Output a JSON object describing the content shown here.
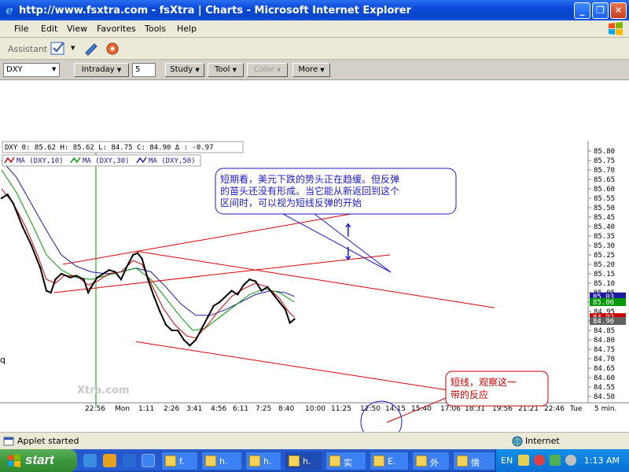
{
  "window": {
    "title": "http://www.fsxtra.com - fsXtra | Charts - Microsoft Internet Explorer",
    "buttons": [
      "_",
      "❐",
      "✕"
    ]
  },
  "menu": [
    "File",
    "Edit",
    "View",
    "Favorites",
    "Tools",
    "Help"
  ],
  "assistant": {
    "label": "Assistant"
  },
  "toolbar": {
    "symbol": "DXY",
    "period": "Intraday",
    "interval": "5",
    "study": "Study",
    "tool": "Tool",
    "color": "Color",
    "more": "More"
  },
  "legend": {
    "quote": "DXY   0: 85.62  H: 85.62  L: 84.75  C: 84.90   Δ : -0.97",
    "ma": [
      "MA (DXY,10)",
      "MA (DXY,30)",
      "MA (DXY,50)"
    ]
  },
  "colors": {
    "price": "#000000",
    "ma10": "#cc0000",
    "ma30": "#009900",
    "ma50": "#1a1aa0",
    "channel": "#e00000",
    "annotation_blue": "#1a1acc",
    "annotation_red": "#cc0000",
    "price_tag_bg": "#1a1aa0",
    "ma10_tag_bg": "#cc0000",
    "ma30_tag_bg": "#009900"
  },
  "annotations": {
    "note_blue": "短期看，美元下跌的势头正在趋缓。但反弹的苗头还没有形成。当它能从新返回到这个区间时，可以视为短线反弹的开始",
    "note_red": "短线，观察这一带的反应",
    "watermark": "Xtra.com",
    "left_label": "q"
  },
  "chart_data": {
    "type": "line",
    "title": "",
    "symbol": "DXY",
    "interval": "5 min.",
    "xlabel": "",
    "ylabel": "",
    "ylim": [
      84.45,
      85.85
    ],
    "yticks": [
      85.8,
      85.75,
      85.7,
      85.65,
      85.6,
      85.55,
      85.5,
      85.45,
      85.4,
      85.35,
      85.3,
      85.25,
      85.2,
      85.15,
      85.1,
      85.05,
      85.0,
      84.95,
      84.9,
      84.85,
      84.8,
      84.75,
      84.7,
      84.65,
      84.6,
      84.55,
      84.5
    ],
    "xticks": [
      "22:56",
      "Mon",
      "1:11",
      "2:26",
      "3:41",
      "4:56",
      "6:11",
      "7:25",
      "8:40",
      "10:00",
      "11:25",
      "12:50",
      "14:15",
      "15:40",
      "17:06",
      "18:31",
      "19:56",
      "21:21",
      "22:46",
      "Tue"
    ],
    "x_unit_label": "5 min.",
    "ohlc_summary": {
      "open": 85.62,
      "high": 85.62,
      "low": 84.75,
      "close": 84.9,
      "change": -0.97
    },
    "last_values": {
      "price": 84.9,
      "ma10": 84.92,
      "ma30": 85.0,
      "ma50": 85.03
    },
    "series": [
      {
        "name": "DXY",
        "points": [
          [
            0,
            85.55
          ],
          [
            4,
            85.57
          ],
          [
            8,
            85.52
          ],
          [
            14,
            85.4
          ],
          [
            20,
            85.3
          ],
          [
            26,
            85.18
          ],
          [
            30,
            85.06
          ],
          [
            33,
            85.05
          ],
          [
            36,
            85.12
          ],
          [
            40,
            85.15
          ],
          [
            46,
            85.13
          ],
          [
            50,
            85.14
          ],
          [
            55,
            85.12
          ],
          [
            58,
            85.05
          ],
          [
            60,
            85.08
          ],
          [
            64,
            85.13
          ],
          [
            68,
            85.15
          ],
          [
            72,
            85.17
          ],
          [
            76,
            85.16
          ],
          [
            80,
            85.12
          ],
          [
            84,
            85.19
          ],
          [
            88,
            85.25
          ],
          [
            91,
            85.26
          ],
          [
            94,
            85.23
          ],
          [
            98,
            85.12
          ],
          [
            102,
            85.03
          ],
          [
            106,
            84.95
          ],
          [
            110,
            84.88
          ],
          [
            114,
            84.85
          ],
          [
            118,
            84.85
          ],
          [
            122,
            84.8
          ],
          [
            126,
            84.77
          ],
          [
            130,
            84.8
          ],
          [
            134,
            84.86
          ],
          [
            138,
            84.92
          ],
          [
            142,
            84.98
          ],
          [
            146,
            85.0
          ],
          [
            150,
            85.03
          ],
          [
            154,
            85.06
          ],
          [
            158,
            85.04
          ],
          [
            162,
            85.09
          ],
          [
            166,
            85.12
          ],
          [
            170,
            85.11
          ],
          [
            174,
            85.06
          ],
          [
            178,
            85.08
          ],
          [
            182,
            85.04
          ],
          [
            186,
            85.0
          ],
          [
            190,
            84.96
          ],
          [
            193,
            84.89
          ],
          [
            196,
            84.91
          ]
        ]
      },
      {
        "name": "MA (DXY,10)",
        "points": [
          [
            0,
            85.6
          ],
          [
            8,
            85.52
          ],
          [
            16,
            85.4
          ],
          [
            24,
            85.25
          ],
          [
            30,
            85.12
          ],
          [
            36,
            85.1
          ],
          [
            42,
            85.14
          ],
          [
            50,
            85.14
          ],
          [
            58,
            85.09
          ],
          [
            64,
            85.11
          ],
          [
            72,
            85.15
          ],
          [
            80,
            85.16
          ],
          [
            88,
            85.22
          ],
          [
            94,
            85.2
          ],
          [
            100,
            85.1
          ],
          [
            108,
            84.97
          ],
          [
            116,
            84.88
          ],
          [
            124,
            84.82
          ],
          [
            130,
            84.81
          ],
          [
            138,
            84.88
          ],
          [
            146,
            84.96
          ],
          [
            154,
            85.03
          ],
          [
            162,
            85.07
          ],
          [
            170,
            85.1
          ],
          [
            178,
            85.08
          ],
          [
            186,
            85.02
          ],
          [
            192,
            84.95
          ],
          [
            196,
            84.92
          ]
        ]
      },
      {
        "name": "MA (DXY,30)",
        "points": [
          [
            0,
            85.7
          ],
          [
            10,
            85.58
          ],
          [
            20,
            85.42
          ],
          [
            30,
            85.25
          ],
          [
            40,
            85.17
          ],
          [
            50,
            85.13
          ],
          [
            60,
            85.12
          ],
          [
            70,
            85.14
          ],
          [
            80,
            85.16
          ],
          [
            90,
            85.18
          ],
          [
            100,
            85.12
          ],
          [
            110,
            85.02
          ],
          [
            120,
            84.92
          ],
          [
            128,
            84.85
          ],
          [
            136,
            84.86
          ],
          [
            146,
            84.92
          ],
          [
            156,
            84.98
          ],
          [
            166,
            85.04
          ],
          [
            176,
            85.07
          ],
          [
            186,
            85.05
          ],
          [
            196,
            85.0
          ]
        ]
      },
      {
        "name": "MA (DXY,50)",
        "points": [
          [
            0,
            85.75
          ],
          [
            10,
            85.66
          ],
          [
            20,
            85.52
          ],
          [
            30,
            85.38
          ],
          [
            40,
            85.25
          ],
          [
            50,
            85.19
          ],
          [
            60,
            85.16
          ],
          [
            70,
            85.15
          ],
          [
            80,
            85.16
          ],
          [
            90,
            85.18
          ],
          [
            100,
            85.16
          ],
          [
            110,
            85.08
          ],
          [
            120,
            84.99
          ],
          [
            130,
            84.93
          ],
          [
            140,
            84.93
          ],
          [
            150,
            84.96
          ],
          [
            160,
            85.0
          ],
          [
            170,
            85.04
          ],
          [
            180,
            85.06
          ],
          [
            190,
            85.05
          ],
          [
            196,
            85.03
          ]
        ]
      }
    ],
    "trendlines": [
      {
        "from": [
          41,
          85.2
        ],
        "to": [
          258,
          85.5
        ]
      },
      {
        "from": [
          35,
          85.05
        ],
        "to": [
          260,
          85.25
        ]
      },
      {
        "from": [
          90,
          85.27
        ],
        "to": [
          330,
          84.97
        ]
      },
      {
        "from": [
          90,
          84.79
        ],
        "to": [
          318,
          84.51
        ]
      }
    ],
    "arrows": [
      {
        "direction": "up",
        "at": [
          232,
          85.38
        ]
      },
      {
        "direction": "down",
        "at": [
          232,
          85.26
        ]
      }
    ]
  }
}
